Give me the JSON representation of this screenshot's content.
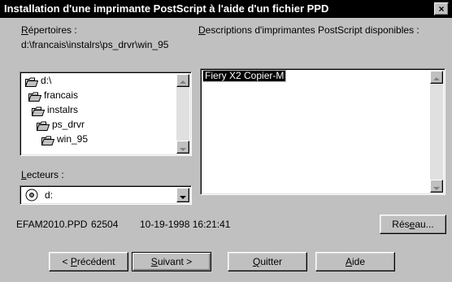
{
  "window": {
    "title": "Installation d'une imprimante PostScript à l'aide d'un fichier PPD",
    "close_label": "×"
  },
  "directories": {
    "label_first": "R",
    "label_rest": "épertoires :",
    "current_path": "d:\\francais\\instalrs\\ps_drvr\\win_95",
    "items": [
      "d:\\",
      "francais",
      "instalrs",
      "ps_drvr",
      "win_95"
    ]
  },
  "descriptions": {
    "label_first": "D",
    "label_rest": "escriptions d'imprimantes PostScript disponibles :",
    "items": [
      "Fiery X2 Copier-M"
    ]
  },
  "drives": {
    "label_first": "L",
    "label_rest": "ecteurs :",
    "selected": "d:"
  },
  "file_info": {
    "filename": "EFAM2010.PPD",
    "size": "62504",
    "datetime": "10-19-1998 16:21:41"
  },
  "buttons": {
    "network_pre": "Rés",
    "network_key": "e",
    "network_post": "au...",
    "prev_pre": "< ",
    "prev_key": "P",
    "prev_post": "récédent",
    "next_key": "S",
    "next_post": "uivant >",
    "quit_key": "Q",
    "quit_post": "uitter",
    "help_key": "A",
    "help_post": "ide"
  },
  "colors": {
    "face": "#c0c0c0",
    "titlebar": "#000000",
    "selection": "#000000"
  }
}
